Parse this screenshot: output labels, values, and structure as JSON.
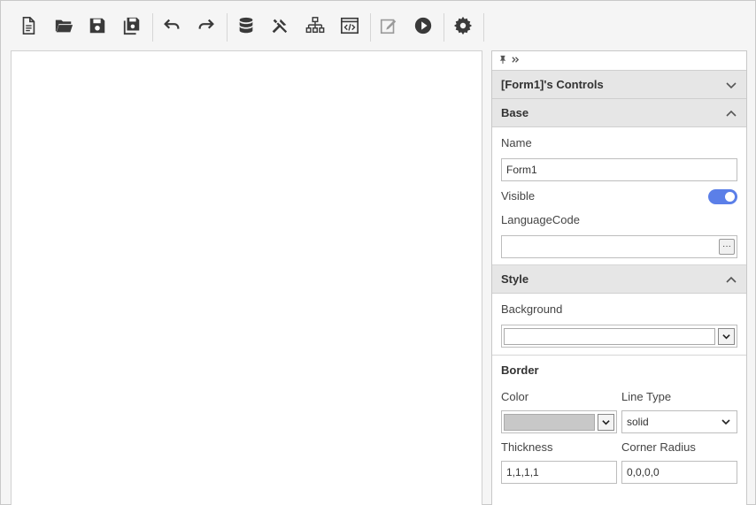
{
  "toolbar": {
    "groups": [
      [
        "new-file-icon",
        "open-folder-icon",
        "save-icon",
        "save-all-icon"
      ],
      [
        "undo-icon",
        "redo-icon"
      ],
      [
        "database-icon",
        "tools-icon",
        "hierarchy-icon",
        "code-window-icon"
      ],
      [
        "edit-icon",
        "run-icon"
      ],
      [
        "settings-icon"
      ]
    ]
  },
  "panel": {
    "controls_header": "[Form1]'s Controls",
    "base": {
      "title": "Base",
      "name_label": "Name",
      "name_value": "Form1",
      "visible_label": "Visible",
      "visible_on": true,
      "language_label": "LanguageCode",
      "language_value": "",
      "dots": "···"
    },
    "style": {
      "title": "Style",
      "background_label": "Background",
      "background_value": ""
    },
    "border": {
      "title": "Border",
      "color_label": "Color",
      "color_swatch": "#c8c8c8",
      "line_type_label": "Line Type",
      "line_type_value": "solid",
      "thickness_label": "Thickness",
      "thickness_value": "1,1,1,1",
      "corner_label": "Corner Radius",
      "corner_value": "0,0,0,0"
    }
  },
  "colors": {
    "accent": "#5b7fe8",
    "icon": "#3a3a3a",
    "icon_disabled": "#9a9a9a"
  }
}
